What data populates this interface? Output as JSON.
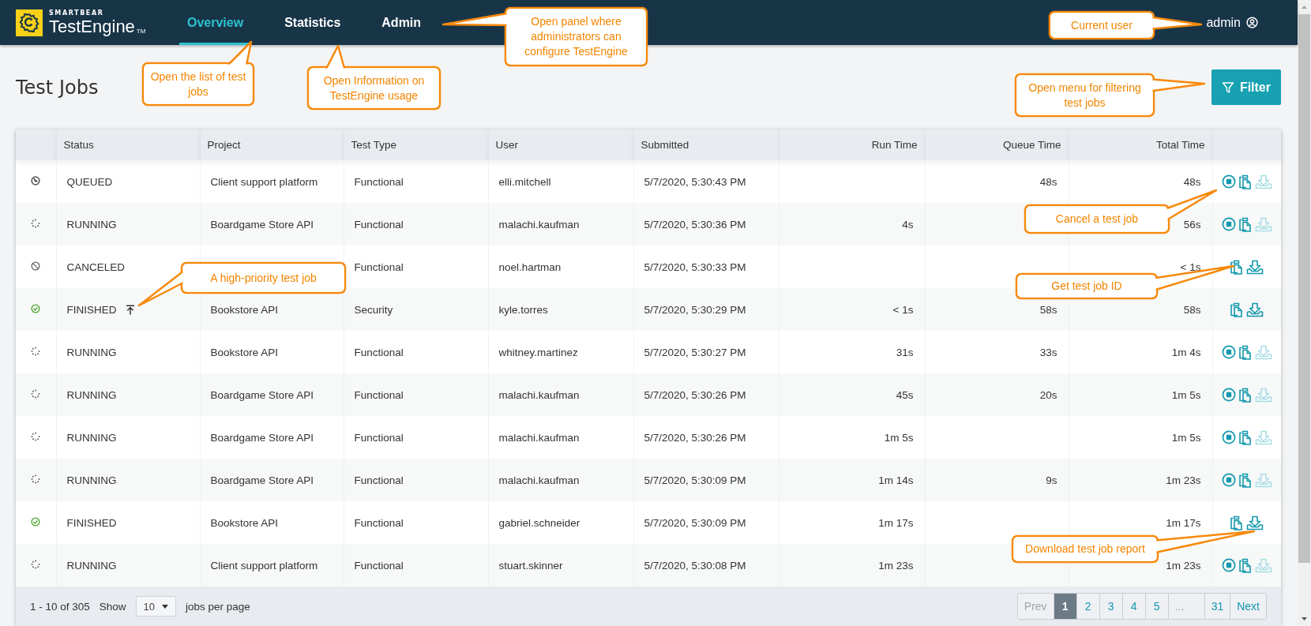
{
  "header": {
    "brand_top": "SMARTBEAR",
    "brand": "TestEngine",
    "trademark": "TM",
    "nav": [
      {
        "label": "Overview",
        "selected": true
      },
      {
        "label": "Statistics",
        "selected": false
      },
      {
        "label": "Admin",
        "selected": false
      }
    ],
    "user": "admin"
  },
  "page": {
    "title": "Test Jobs",
    "filter_button": "Filter"
  },
  "table": {
    "columns": [
      "Status",
      "Project",
      "Test Type",
      "User",
      "Submitted",
      "Run Time",
      "Queue Time",
      "Total Time"
    ],
    "rows": [
      {
        "kind": "queued",
        "status": "QUEUED",
        "high_priority": false,
        "project": "Client support platform",
        "test_type": "Functional",
        "user": "elli.mitchell",
        "submitted": "5/7/2020, 5:30:43 PM",
        "queue_time": "48s",
        "total_time": "48s",
        "cancelable": true,
        "report_ready": false
      },
      {
        "kind": "running",
        "status": "RUNNING",
        "high_priority": false,
        "project": "Boardgame Store API",
        "test_type": "Functional",
        "user": "malachi.kaufman",
        "submitted": "5/7/2020, 5:30:36 PM",
        "run_time": "4s",
        "total_time": "56s",
        "cancelable": true,
        "report_ready": false
      },
      {
        "kind": "canceled",
        "status": "CANCELED",
        "high_priority": false,
        "test_type": "Functional",
        "user": "noel.hartman",
        "submitted": "5/7/2020, 5:30:33 PM",
        "total_time": "< 1s",
        "cancelable": false,
        "report_ready": true
      },
      {
        "kind": "finished",
        "status": "FINISHED",
        "high_priority": true,
        "project": "Bookstore API",
        "test_type": "Security",
        "user": "kyle.torres",
        "submitted": "5/7/2020, 5:30:29 PM",
        "run_time": "< 1s",
        "queue_time": "58s",
        "total_time": "58s",
        "cancelable": false,
        "report_ready": true
      },
      {
        "kind": "running",
        "status": "RUNNING",
        "high_priority": false,
        "project": "Bookstore API",
        "test_type": "Functional",
        "user": "whitney.martinez",
        "submitted": "5/7/2020, 5:30:27 PM",
        "run_time": "31s",
        "queue_time": "33s",
        "total_time": "1m 4s",
        "cancelable": true,
        "report_ready": false
      },
      {
        "kind": "running",
        "status": "RUNNING",
        "high_priority": false,
        "project": "Boardgame Store API",
        "test_type": "Functional",
        "user": "malachi.kaufman",
        "submitted": "5/7/2020, 5:30:26 PM",
        "run_time": "45s",
        "queue_time": "20s",
        "total_time": "1m 5s",
        "cancelable": true,
        "report_ready": false
      },
      {
        "kind": "running",
        "status": "RUNNING",
        "high_priority": false,
        "project": "Boardgame Store API",
        "test_type": "Functional",
        "user": "malachi.kaufman",
        "submitted": "5/7/2020, 5:30:26 PM",
        "run_time": "1m 5s",
        "total_time": "1m 5s",
        "cancelable": true,
        "report_ready": false
      },
      {
        "kind": "running",
        "status": "RUNNING",
        "high_priority": false,
        "project": "Boardgame Store API",
        "test_type": "Functional",
        "user": "malachi.kaufman",
        "submitted": "5/7/2020, 5:30:09 PM",
        "run_time": "1m 14s",
        "queue_time": "9s",
        "total_time": "1m 23s",
        "cancelable": true,
        "report_ready": false
      },
      {
        "kind": "finished",
        "status": "FINISHED",
        "high_priority": false,
        "project": "Bookstore API",
        "test_type": "Functional",
        "user": "gabriel.schneider",
        "submitted": "5/7/2020, 5:30:09 PM",
        "run_time": "1m 17s",
        "total_time": "1m 17s",
        "cancelable": false,
        "report_ready": true
      },
      {
        "kind": "running",
        "status": "RUNNING",
        "high_priority": false,
        "project": "Client support platform",
        "test_type": "Functional",
        "user": "stuart.skinner",
        "submitted": "5/7/2020, 5:30:08 PM",
        "run_time": "1m 23s",
        "total_time": "1m 23s",
        "cancelable": true,
        "report_ready": false
      }
    ]
  },
  "pagination": {
    "summary": "1 - 10 of 305",
    "show_label": "Show",
    "page_size": "10",
    "per_page_label": "jobs per page",
    "prev": {
      "label": "Prev",
      "disabled": true
    },
    "pages": [
      {
        "kind": "page",
        "label": "1",
        "selected": true
      },
      {
        "kind": "page",
        "label": "2",
        "selected": false
      },
      {
        "kind": "page",
        "label": "3",
        "selected": false
      },
      {
        "kind": "page",
        "label": "4",
        "selected": false
      },
      {
        "kind": "page",
        "label": "5",
        "selected": false
      },
      {
        "kind": "gap",
        "label": "...",
        "selected": false
      },
      {
        "kind": "page",
        "label": "31",
        "selected": false
      }
    ],
    "next": {
      "label": "Next",
      "disabled": false
    }
  },
  "callouts": [
    "Open the list of test jobs",
    "Open Information on TestEngine usage",
    "Open panel where administrators can configure TestEngine",
    "Current user",
    "Open menu for filtering test jobs",
    "A high-priority test job",
    "Cancel a test job",
    "Get test job ID",
    "Download test job report"
  ]
}
